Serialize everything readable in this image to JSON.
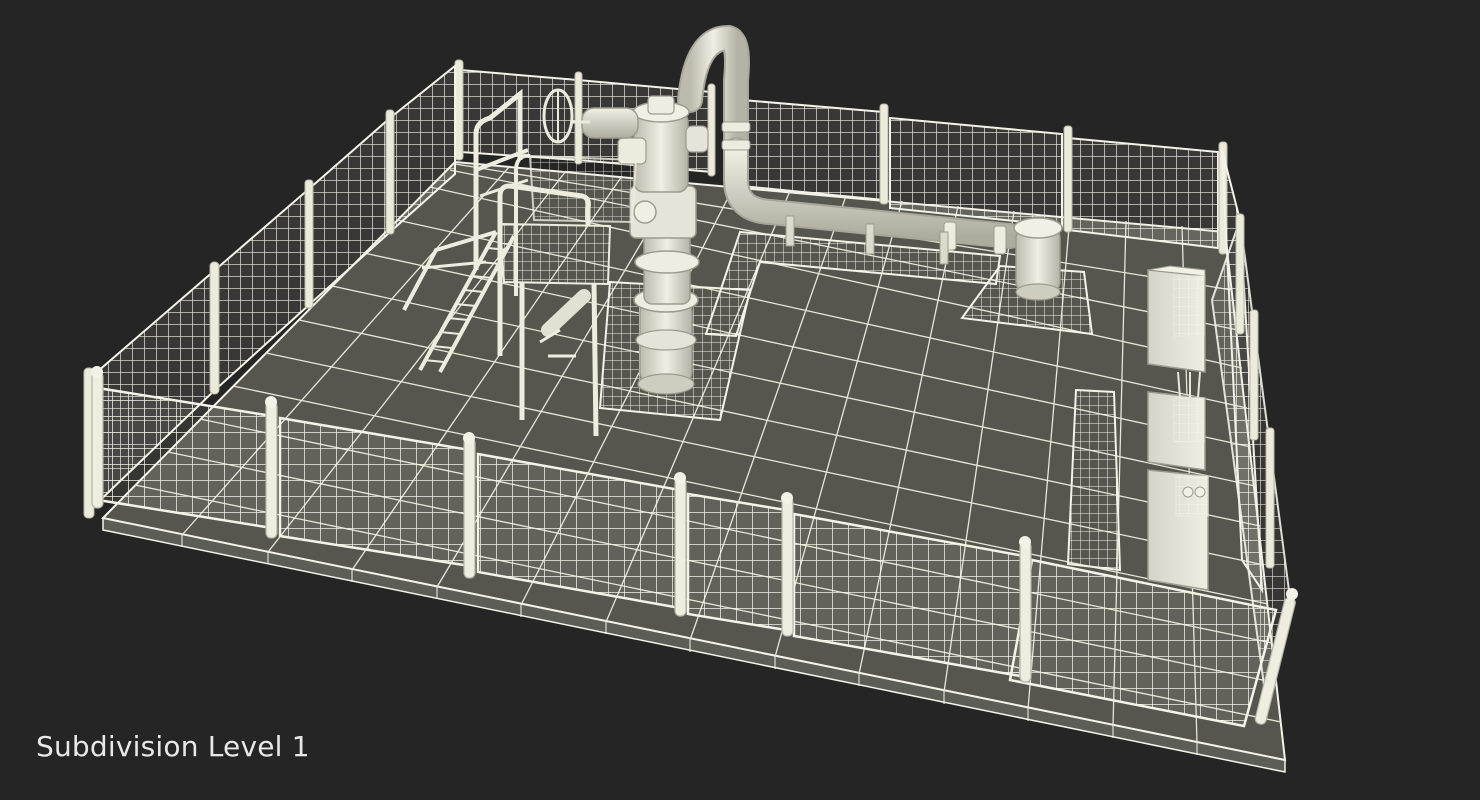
{
  "caption": {
    "text": "Subdivision Level 1"
  },
  "colors": {
    "background": "#252525",
    "floor": "#55554f",
    "wire": "#f2f1e6",
    "model": "#e9e7da",
    "shadow": "#3d3d38"
  },
  "scene": {
    "subject": "wellhead-platform-3d-model",
    "view": "perspective"
  }
}
